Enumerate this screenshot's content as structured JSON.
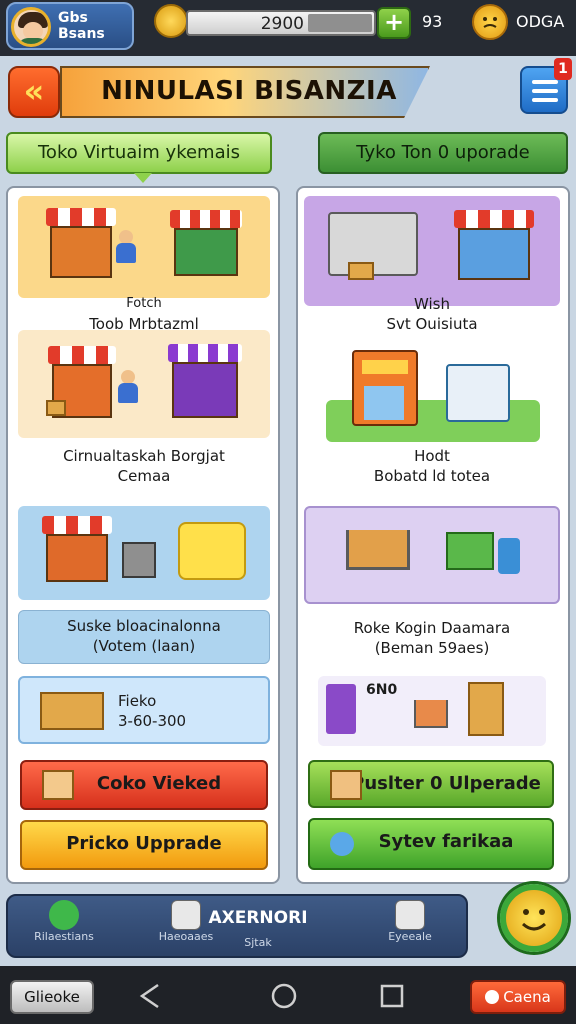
{
  "profile": {
    "name_line1": "Gbs",
    "name_line2": "Bsans"
  },
  "resources": {
    "coins": "2900",
    "plus_label": "+",
    "gems": "93",
    "currency": "ODGA"
  },
  "header": {
    "back_label": "«",
    "title": "NINULASI BISANZIA",
    "menu_badge": "1"
  },
  "tabs": [
    {
      "label": "Toko Virtuaim ykemais",
      "active": true
    },
    {
      "label": "Tyko Ton 0 uporade",
      "active": false
    }
  ],
  "left_panel": {
    "cards": [
      {
        "caption_line1": "Fotch",
        "caption_line2": "Toob Mrbtazml"
      },
      {
        "caption_line1": "Cirnualtaskah Borgjat",
        "caption_line2": "Cemaa"
      },
      {
        "caption_line1": "Suske bloacinalonna",
        "caption_line2": "(Votem (laan)"
      }
    ],
    "price_card": {
      "name": "Fieko",
      "price": "3-60-300"
    },
    "buttons": {
      "primary": "Coko Vieked",
      "secondary": "Pricko Upprade"
    }
  },
  "right_panel": {
    "cards": [
      {
        "caption_line1": "Wish",
        "caption_line2": "Svt Ouisiuta"
      },
      {
        "caption_line1": "Hodt",
        "caption_line2": "Bobatd ld totea"
      },
      {
        "caption_line1": "Roke Kogin Daamara",
        "caption_line2": "(Beman 59aes)"
      }
    ],
    "promo": {
      "badge": "6N0"
    },
    "buttons": {
      "primary": "Puslter 0 Ulperade",
      "secondary": "Sytev farikaa"
    }
  },
  "bottom_nav": {
    "items": [
      {
        "label": "Rilaestians",
        "icon": "magnifier-icon"
      },
      {
        "label": "Haeoaaes",
        "icon": "box-icon"
      },
      {
        "label": "Eyeeale",
        "icon": "gift-box-icon"
      }
    ],
    "center_title": "AXERNORI",
    "center_sub": "Sjtak"
  },
  "system_bar": {
    "left_label": "Glieoke",
    "right_label": "Caena"
  },
  "colors": {
    "accent_orange": "#e03c0c",
    "accent_green": "#4a9a1d",
    "accent_blue": "#1f6cc6"
  }
}
